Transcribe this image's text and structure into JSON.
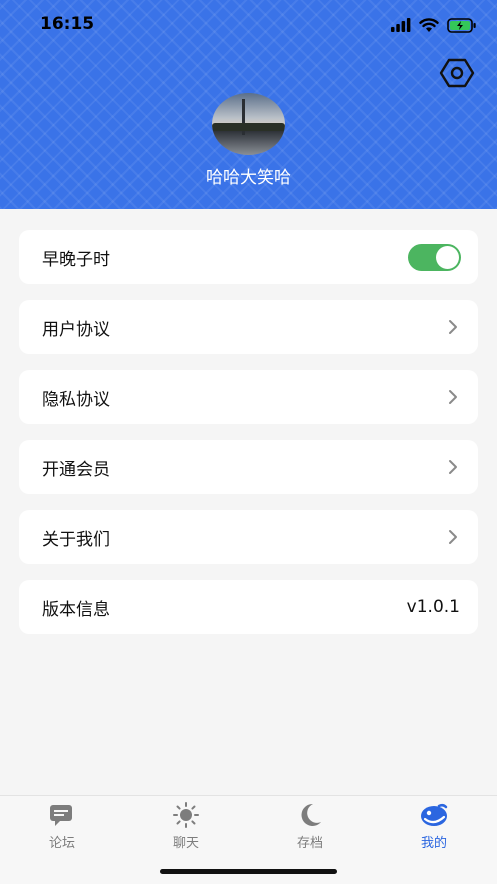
{
  "status_bar": {
    "time": "16:15"
  },
  "profile": {
    "username": "哈哈大笑哈"
  },
  "menu": [
    {
      "label": "早晚子时",
      "type": "toggle",
      "enabled": true
    },
    {
      "label": "用户协议",
      "type": "link"
    },
    {
      "label": "隐私协议",
      "type": "link"
    },
    {
      "label": "开通会员",
      "type": "link"
    },
    {
      "label": "关于我们",
      "type": "link"
    },
    {
      "label": "版本信息",
      "type": "value",
      "value": "v1.0.1"
    }
  ],
  "tabs": [
    {
      "label": "论坛",
      "icon": "forum-icon",
      "active": false
    },
    {
      "label": "聊天",
      "icon": "sun-icon",
      "active": false
    },
    {
      "label": "存档",
      "icon": "moon-icon",
      "active": false
    },
    {
      "label": "我的",
      "icon": "profile-icon",
      "active": true
    }
  ],
  "colors": {
    "header_blue": "#3a73e8",
    "toggle_green": "#4cb560",
    "active_tab": "#2b66e0"
  }
}
